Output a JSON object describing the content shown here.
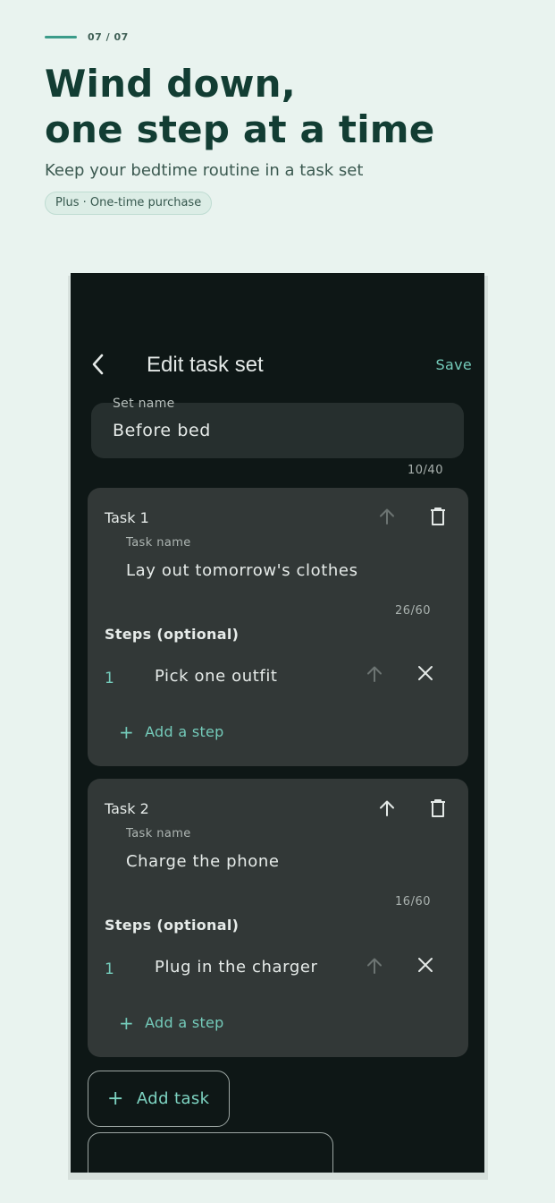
{
  "promo": {
    "counter": "07 / 07",
    "title_line1": "Wind down,",
    "title_line2": "one step at a time",
    "subtitle": "Keep your bedtime routine in a task set",
    "badge": "Plus · One-time purchase"
  },
  "appbar": {
    "back_icon": "chevron-left-icon",
    "title": "Edit task set",
    "save_label": "Save"
  },
  "set_name": {
    "label": "Set name",
    "value": "Before bed",
    "counter": "10/40"
  },
  "tasks": [
    {
      "title": "Task 1",
      "name_label": "Task name",
      "name_value": "Lay out tomorrow's clothes",
      "counter": "26/60",
      "steps_label": "Steps (optional)",
      "steps": [
        {
          "num": "1",
          "text": "Pick one outfit"
        }
      ],
      "add_step_label": "Add a step",
      "move_up_enabled": false
    },
    {
      "title": "Task 2",
      "name_label": "Task name",
      "name_value": "Charge the phone",
      "counter": "16/60",
      "steps_label": "Steps (optional)",
      "steps": [
        {
          "num": "1",
          "text": "Plug in the charger"
        }
      ],
      "add_step_label": "Add a step",
      "move_up_enabled": true
    }
  ],
  "add_task_label": "Add task",
  "colors": {
    "accent": "#74cbba",
    "background": "#0e1716",
    "card": "#323837",
    "promo_bg": "#e9f3ef",
    "promo_title": "#123d33"
  }
}
